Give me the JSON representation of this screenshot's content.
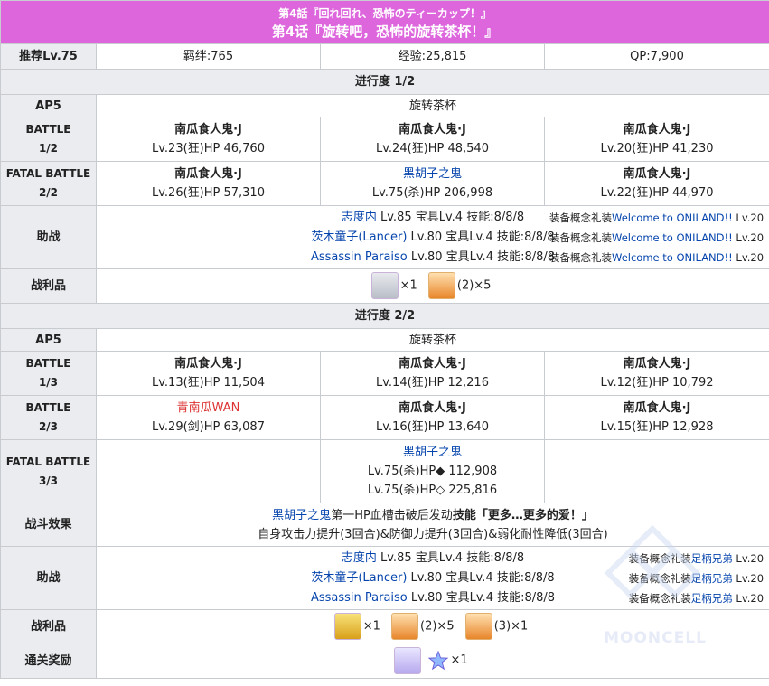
{
  "header": {
    "title_jp": "第4話『回れ回れ、恐怖のティーカップ！』",
    "title_cn": "第4话『旋转吧，恐怖的旋转茶杯！』"
  },
  "summary": {
    "recommended_level": "推荐Lv.75",
    "bond": "羁绊:765",
    "exp": "经验:25,815",
    "qp": "QP:7,900"
  },
  "part1": {
    "progress": "进行度 1/2",
    "ap_label": "AP5",
    "stage_name": "旋转茶杯",
    "battle1_label_a": "BATTLE",
    "battle1_label_b": "1/2",
    "battle1": [
      {
        "name": "南瓜食人鬼·J",
        "stats": "Lv.23(狂)HP 46,760"
      },
      {
        "name": "南瓜食人鬼·J",
        "stats": "Lv.24(狂)HP 48,540"
      },
      {
        "name": "南瓜食人鬼·J",
        "stats": "Lv.20(狂)HP 41,230"
      }
    ],
    "battle2_label_a": "FATAL BATTLE",
    "battle2_label_b": "2/2",
    "battle2": [
      {
        "name": "南瓜食人鬼·J",
        "stats": "Lv.26(狂)HP 57,310"
      },
      {
        "name": "黑胡子之鬼",
        "stats": "Lv.75(杀)HP 206,998"
      },
      {
        "name": "南瓜食人鬼·J",
        "stats": "Lv.22(狂)HP 44,970"
      }
    ],
    "support_label": "助战",
    "supports": [
      {
        "servant": "志度内",
        "detail": " Lv.85 宝具Lv.4 技能:8/8/8",
        "ce_prefix": "装备概念礼装",
        "ce_name": "Welcome to ONILAND!!",
        "ce_level": " Lv.20"
      },
      {
        "servant": "茨木童子(Lancer)",
        "detail": " Lv.80 宝具Lv.4 技能:8/8/8",
        "ce_prefix": "装备概念礼装",
        "ce_name": "Welcome to ONILAND!!",
        "ce_level": " Lv.20"
      },
      {
        "servant": "Assassin Paraiso",
        "detail": " Lv.80 宝具Lv.4 技能:8/8/8",
        "ce_prefix": "装备概念礼装",
        "ce_name": "Welcome to ONILAND!!",
        "ce_level": " Lv.20"
      }
    ],
    "drops_label": "战利品",
    "drops": [
      {
        "icon": "silver-statue-icon",
        "qty": "×1"
      },
      {
        "icon": "pumpkin-lantern-icon",
        "qty": "(2)×5"
      }
    ]
  },
  "part2": {
    "progress": "进行度 2/2",
    "ap_label": "AP5",
    "stage_name": "旋转茶杯",
    "battle1_label_a": "BATTLE",
    "battle1_label_b": "1/3",
    "battle1": [
      {
        "name": "南瓜食人鬼·J",
        "stats": "Lv.13(狂)HP 11,504"
      },
      {
        "name": "南瓜食人鬼·J",
        "stats": "Lv.14(狂)HP 12,216"
      },
      {
        "name": "南瓜食人鬼·J",
        "stats": "Lv.12(狂)HP 10,792"
      }
    ],
    "battle2_label_a": "BATTLE",
    "battle2_label_b": "2/3",
    "battle2": [
      {
        "name": "青南瓜WAN",
        "stats": "Lv.29(剑)HP 63,087"
      },
      {
        "name": "南瓜食人鬼·J",
        "stats": "Lv.16(狂)HP 13,640"
      },
      {
        "name": "南瓜食人鬼·J",
        "stats": "Lv.15(狂)HP 12,928"
      }
    ],
    "battle3_label_a": "FATAL BATTLE",
    "battle3_label_b": "3/3",
    "battle3_boss": {
      "name": "黑胡子之鬼",
      "stats1": "Lv.75(杀)HP◆ 112,908",
      "stats2": "Lv.75(杀)HP◇ 225,816"
    },
    "effect_label": "战斗效果",
    "effect_line1_name": "黑胡子之鬼",
    "effect_line1_text": "第一HP血槽击破后发动",
    "effect_line1_skill": "技能「更多…更多的爱！」",
    "effect_line2": "自身攻击力提升(3回合)&防御力提升(3回合)&弱化耐性降低(3回合)",
    "support_label": "助战",
    "supports": [
      {
        "servant": "志度内",
        "detail": " Lv.85 宝具Lv.4 技能:8/8/8",
        "ce_prefix": "装备概念礼装",
        "ce_name": "足柄兄弟",
        "ce_level": " Lv.20"
      },
      {
        "servant": "茨木童子(Lancer)",
        "detail": " Lv.80 宝具Lv.4 技能:8/8/8",
        "ce_prefix": "装备概念礼装",
        "ce_name": "足柄兄弟",
        "ce_level": " Lv.20"
      },
      {
        "servant": "Assassin Paraiso",
        "detail": " Lv.80 宝具Lv.4 技能:8/8/8",
        "ce_prefix": "装备概念礼装",
        "ce_name": "足柄兄弟",
        "ce_level": " Lv.20"
      }
    ],
    "drops_label": "战利品",
    "drops": [
      {
        "icon": "gold-statue-icon",
        "qty": "×1"
      },
      {
        "icon": "pumpkin-lantern-icon",
        "qty": "(2)×5"
      },
      {
        "icon": "pumpkin-lantern-icon",
        "qty": "(3)×1"
      }
    ],
    "reward_label": "通关奖励",
    "rewards": [
      {
        "icon": "craft-essence-icon",
        "qty": ""
      },
      {
        "icon": "saint-quartz-icon",
        "qty": "×1"
      }
    ]
  },
  "watermark": "MOONCELL",
  "colors": {
    "header": "#dd66dd",
    "link": "#0645ad",
    "red_link": "#dd3333",
    "label_bg": "#eaecf0"
  }
}
